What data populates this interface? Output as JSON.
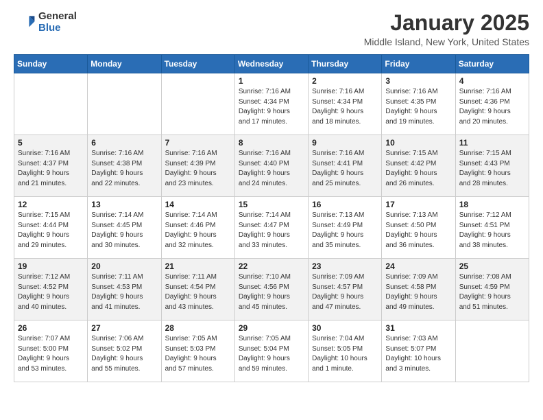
{
  "logo": {
    "general": "General",
    "blue": "Blue"
  },
  "header": {
    "title": "January 2025",
    "subtitle": "Middle Island, New York, United States"
  },
  "days_of_week": [
    "Sunday",
    "Monday",
    "Tuesday",
    "Wednesday",
    "Thursday",
    "Friday",
    "Saturday"
  ],
  "weeks": [
    [
      {
        "day": "",
        "info": ""
      },
      {
        "day": "",
        "info": ""
      },
      {
        "day": "",
        "info": ""
      },
      {
        "day": "1",
        "info": "Sunrise: 7:16 AM\nSunset: 4:34 PM\nDaylight: 9 hours\nand 17 minutes."
      },
      {
        "day": "2",
        "info": "Sunrise: 7:16 AM\nSunset: 4:34 PM\nDaylight: 9 hours\nand 18 minutes."
      },
      {
        "day": "3",
        "info": "Sunrise: 7:16 AM\nSunset: 4:35 PM\nDaylight: 9 hours\nand 19 minutes."
      },
      {
        "day": "4",
        "info": "Sunrise: 7:16 AM\nSunset: 4:36 PM\nDaylight: 9 hours\nand 20 minutes."
      }
    ],
    [
      {
        "day": "5",
        "info": "Sunrise: 7:16 AM\nSunset: 4:37 PM\nDaylight: 9 hours\nand 21 minutes."
      },
      {
        "day": "6",
        "info": "Sunrise: 7:16 AM\nSunset: 4:38 PM\nDaylight: 9 hours\nand 22 minutes."
      },
      {
        "day": "7",
        "info": "Sunrise: 7:16 AM\nSunset: 4:39 PM\nDaylight: 9 hours\nand 23 minutes."
      },
      {
        "day": "8",
        "info": "Sunrise: 7:16 AM\nSunset: 4:40 PM\nDaylight: 9 hours\nand 24 minutes."
      },
      {
        "day": "9",
        "info": "Sunrise: 7:16 AM\nSunset: 4:41 PM\nDaylight: 9 hours\nand 25 minutes."
      },
      {
        "day": "10",
        "info": "Sunrise: 7:15 AM\nSunset: 4:42 PM\nDaylight: 9 hours\nand 26 minutes."
      },
      {
        "day": "11",
        "info": "Sunrise: 7:15 AM\nSunset: 4:43 PM\nDaylight: 9 hours\nand 28 minutes."
      }
    ],
    [
      {
        "day": "12",
        "info": "Sunrise: 7:15 AM\nSunset: 4:44 PM\nDaylight: 9 hours\nand 29 minutes."
      },
      {
        "day": "13",
        "info": "Sunrise: 7:14 AM\nSunset: 4:45 PM\nDaylight: 9 hours\nand 30 minutes."
      },
      {
        "day": "14",
        "info": "Sunrise: 7:14 AM\nSunset: 4:46 PM\nDaylight: 9 hours\nand 32 minutes."
      },
      {
        "day": "15",
        "info": "Sunrise: 7:14 AM\nSunset: 4:47 PM\nDaylight: 9 hours\nand 33 minutes."
      },
      {
        "day": "16",
        "info": "Sunrise: 7:13 AM\nSunset: 4:49 PM\nDaylight: 9 hours\nand 35 minutes."
      },
      {
        "day": "17",
        "info": "Sunrise: 7:13 AM\nSunset: 4:50 PM\nDaylight: 9 hours\nand 36 minutes."
      },
      {
        "day": "18",
        "info": "Sunrise: 7:12 AM\nSunset: 4:51 PM\nDaylight: 9 hours\nand 38 minutes."
      }
    ],
    [
      {
        "day": "19",
        "info": "Sunrise: 7:12 AM\nSunset: 4:52 PM\nDaylight: 9 hours\nand 40 minutes."
      },
      {
        "day": "20",
        "info": "Sunrise: 7:11 AM\nSunset: 4:53 PM\nDaylight: 9 hours\nand 41 minutes."
      },
      {
        "day": "21",
        "info": "Sunrise: 7:11 AM\nSunset: 4:54 PM\nDaylight: 9 hours\nand 43 minutes."
      },
      {
        "day": "22",
        "info": "Sunrise: 7:10 AM\nSunset: 4:56 PM\nDaylight: 9 hours\nand 45 minutes."
      },
      {
        "day": "23",
        "info": "Sunrise: 7:09 AM\nSunset: 4:57 PM\nDaylight: 9 hours\nand 47 minutes."
      },
      {
        "day": "24",
        "info": "Sunrise: 7:09 AM\nSunset: 4:58 PM\nDaylight: 9 hours\nand 49 minutes."
      },
      {
        "day": "25",
        "info": "Sunrise: 7:08 AM\nSunset: 4:59 PM\nDaylight: 9 hours\nand 51 minutes."
      }
    ],
    [
      {
        "day": "26",
        "info": "Sunrise: 7:07 AM\nSunset: 5:00 PM\nDaylight: 9 hours\nand 53 minutes."
      },
      {
        "day": "27",
        "info": "Sunrise: 7:06 AM\nSunset: 5:02 PM\nDaylight: 9 hours\nand 55 minutes."
      },
      {
        "day": "28",
        "info": "Sunrise: 7:05 AM\nSunset: 5:03 PM\nDaylight: 9 hours\nand 57 minutes."
      },
      {
        "day": "29",
        "info": "Sunrise: 7:05 AM\nSunset: 5:04 PM\nDaylight: 9 hours\nand 59 minutes."
      },
      {
        "day": "30",
        "info": "Sunrise: 7:04 AM\nSunset: 5:05 PM\nDaylight: 10 hours\nand 1 minute."
      },
      {
        "day": "31",
        "info": "Sunrise: 7:03 AM\nSunset: 5:07 PM\nDaylight: 10 hours\nand 3 minutes."
      },
      {
        "day": "",
        "info": ""
      }
    ]
  ]
}
